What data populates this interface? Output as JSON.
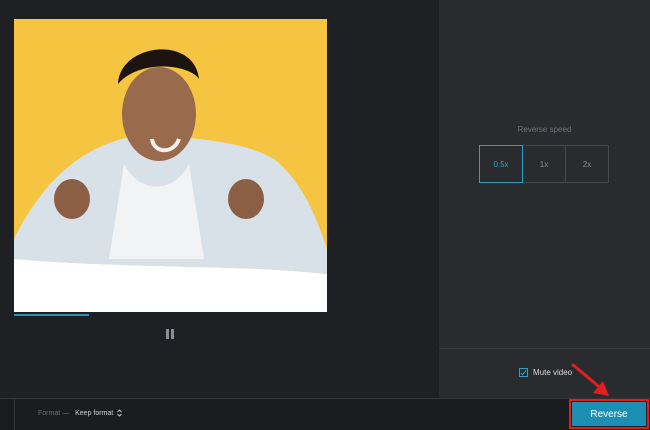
{
  "speed": {
    "label": "Reverse speed",
    "options": [
      "0.5x",
      "1x",
      "2x"
    ],
    "selected": "0.5x"
  },
  "mute": {
    "label": "Mute video",
    "checked": true
  },
  "format": {
    "label": "Format —",
    "value": "Keep format"
  },
  "player": {
    "progress_fraction": 0.24
  },
  "actions": {
    "reverse": "Reverse"
  },
  "colors": {
    "accent": "#2aa3c2",
    "highlight": "#e0201f"
  }
}
